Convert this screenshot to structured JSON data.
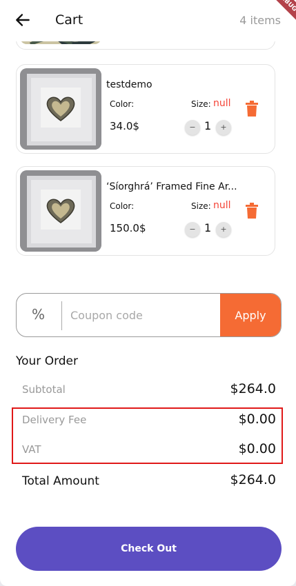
{
  "appbar": {
    "title": "Cart",
    "count": "4 items",
    "debug_banner": "DEBUG"
  },
  "items": [
    {
      "name": "testdemo",
      "color_label": "Color:",
      "size_label": "Size:",
      "size_value": "null",
      "price": "34.0$",
      "qty": "1",
      "minus": "−",
      "plus": "+"
    },
    {
      "name": "‘Síorghrá’ Framed Fine Ar...",
      "color_label": "Color:",
      "size_label": "Size:",
      "size_value": "null",
      "price": "150.0$",
      "qty": "1",
      "minus": "−",
      "plus": "+"
    }
  ],
  "coupon": {
    "icon": "%",
    "placeholder": "Coupon code",
    "apply": "Apply"
  },
  "order": {
    "heading": "Your Order",
    "subtotal_label": "Subtotal",
    "subtotal": "$264.0",
    "delivery_label": "Delivery Fee",
    "delivery": "$0.00",
    "vat_label": "VAT",
    "vat": "$0.00",
    "total_label": "Total Amount",
    "total": "$264.0"
  },
  "checkout": "Check Out",
  "colors": {
    "accent": "#f56b34",
    "primary": "#5c4ec2",
    "null_text": "#f44336",
    "highlight": "#e01818"
  }
}
